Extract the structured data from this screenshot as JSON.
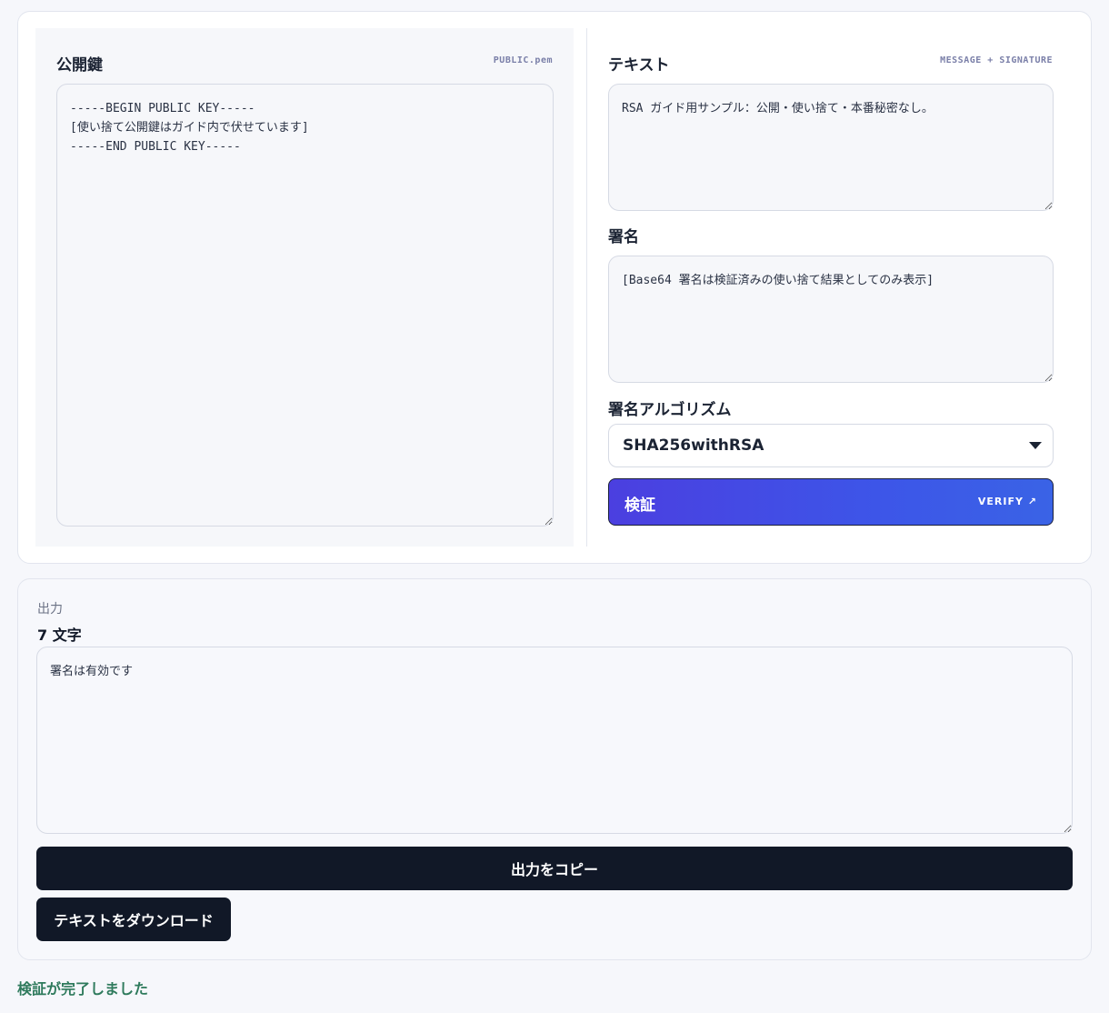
{
  "public_key": {
    "title": "公開鍵",
    "tag": "PUBLIC.pem",
    "value": "-----BEGIN PUBLIC KEY-----\n[使い捨て公開鍵はガイド内で伏せています]\n-----END PUBLIC KEY-----"
  },
  "message": {
    "title": "テキスト",
    "tag": "MESSAGE + SIGNATURE",
    "value": "RSA ガイド用サンプル：公開・使い捨て・本番秘密なし。"
  },
  "signature": {
    "label": "署名",
    "value": "[Base64 署名は検証済みの使い捨て結果としてのみ表示]"
  },
  "algorithm": {
    "label": "署名アルゴリズム",
    "selected": "SHA256withRSA"
  },
  "verify_button": {
    "label": "検証",
    "tag": "VERIFY ↗"
  },
  "output": {
    "label": "出力",
    "count": "7 文字",
    "value": "署名は有効です",
    "copy_label": "出力をコピー",
    "download_label": "テキストをダウンロード"
  },
  "status": "検証が完了しました"
}
